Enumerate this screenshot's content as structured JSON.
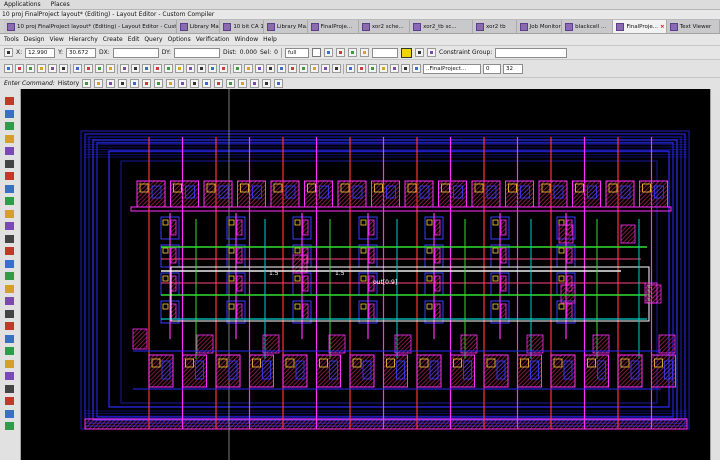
{
  "system_bar": {
    "applications": "Applications",
    "places": "Places"
  },
  "window_title": "10 proj FinalProject layout* (Editing) - Layout Editor - Custom Compiler",
  "tabs": [
    {
      "label": "10 proj FinalProject layout* (Editing) - Layout Editor - Custom Compiler"
    },
    {
      "label": "Library Ma..."
    },
    {
      "label": "10 bit CA 1..."
    },
    {
      "label": "Library Ma..."
    },
    {
      "label": "FinalProje..."
    },
    {
      "label": "xor2 sche..."
    },
    {
      "label": "xor2_tb sc..."
    },
    {
      "label": "xor2 tb"
    },
    {
      "label": "Job Monitor"
    },
    {
      "label": "blackcell ..."
    },
    {
      "label": "FinalProje..."
    },
    {
      "label": "Text Viewer"
    }
  ],
  "menu": [
    "Tools",
    "Design",
    "View",
    "Hierarchy",
    "Create",
    "Edit",
    "Query",
    "Options",
    "Verification",
    "Window",
    "Help"
  ],
  "coords": {
    "x_label": "X:",
    "x_value": "12.990",
    "y_label": "Y:",
    "y_value": "30.672",
    "dx_label": "DX:",
    "dy_label": "DY:",
    "dist_label": "Dist:",
    "dist_value": "0.000",
    "sel_label": "Sel:",
    "sel_value": "0",
    "filter_value": "full",
    "constraint_label": "Constraint Group:"
  },
  "toolbar2": {
    "design_field": "..FinalProject...",
    "level_a": "0",
    "level_b": "32"
  },
  "cmdbar": {
    "label": "Enter Command:",
    "history": "History"
  },
  "canvas_labels": [
    "1.5",
    "1.5",
    "out[0:9]"
  ],
  "colors": {
    "metal1": "#2a2aff",
    "metal2": "#ff2fff",
    "poly": "#ff3333",
    "diffusion": "#33dd33",
    "nwell": "#00cccc",
    "contact": "#ffcc33",
    "pwell_fill": "#b0245a"
  }
}
